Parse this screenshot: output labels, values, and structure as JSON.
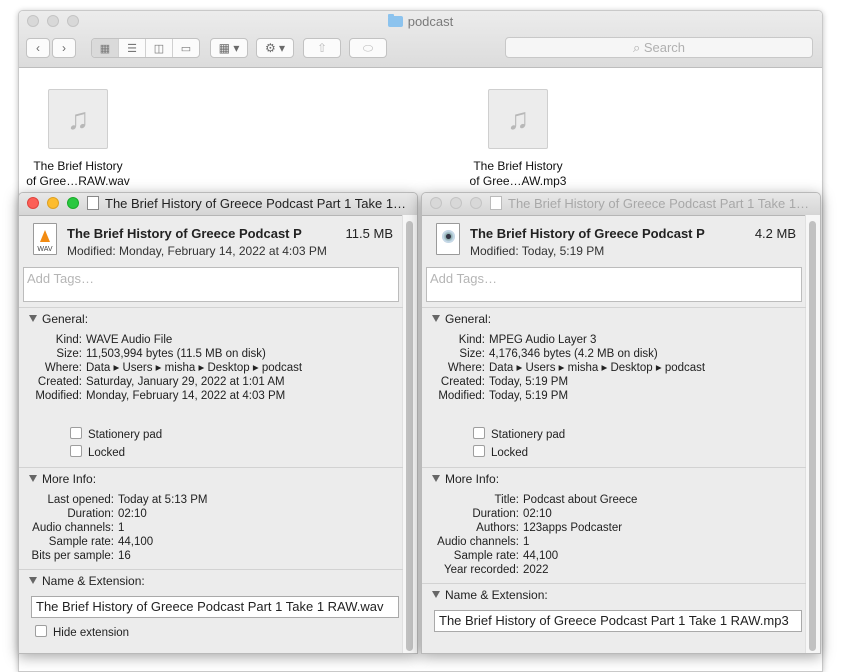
{
  "finder": {
    "title": "podcast",
    "search_placeholder": "Search",
    "files": [
      {
        "line1": "The Brief History",
        "line2": "of Gree…RAW.wav",
        "icon": "music-note-icon"
      },
      {
        "line1": "The Brief History",
        "line2": "of Gree…AW.mp3",
        "icon": "music-note-icon"
      }
    ]
  },
  "wav_info": {
    "window_title": "The Brief History of Greece Podcast Part 1 Take 1…",
    "name": "The Brief History of Greece Podcast Par…",
    "size": "11.5 MB",
    "modified_line": "Modified: Monday, February 14, 2022 at 4:03 PM",
    "icon_label": "WAV",
    "tags_placeholder": "Add Tags…",
    "general_label": "General:",
    "general": [
      {
        "k": "Kind:",
        "v": "WAVE Audio File"
      },
      {
        "k": "Size:",
        "v": "11,503,994 bytes (11.5 MB on disk)"
      },
      {
        "k": "Where:",
        "v": "Data ▸ Users ▸ misha ▸ Desktop ▸ podcast"
      },
      {
        "k": "Created:",
        "v": "Saturday, January 29, 2022 at 1:01 AM"
      },
      {
        "k": "Modified:",
        "v": "Monday, February 14, 2022 at 4:03 PM"
      }
    ],
    "stationery_label": "Stationery pad",
    "locked_label": "Locked",
    "more_info_label": "More Info:",
    "more_info": [
      {
        "k": "Last opened:",
        "v": "Today at 5:13 PM"
      },
      {
        "k": "Duration:",
        "v": "02:10"
      },
      {
        "k": "Audio channels:",
        "v": "1"
      },
      {
        "k": "Sample rate:",
        "v": "44,100"
      },
      {
        "k": "Bits per sample:",
        "v": "16"
      }
    ],
    "name_ext_label": "Name & Extension:",
    "name_ext_value": "The Brief History of Greece Podcast Part 1 Take 1 RAW.wav",
    "hide_ext_label": "Hide extension"
  },
  "mp3_info": {
    "window_title": "The Brief History of Greece Podcast Part 1 Take 1…",
    "name": "The Brief History of Greece Podcast Part…",
    "size": "4.2 MB",
    "modified_line": "Modified: Today, 5:19 PM",
    "tags_placeholder": "Add Tags…",
    "general_label": "General:",
    "general": [
      {
        "k": "Kind:",
        "v": "MPEG Audio Layer 3"
      },
      {
        "k": "Size:",
        "v": "4,176,346 bytes (4.2 MB on disk)"
      },
      {
        "k": "Where:",
        "v": "Data ▸ Users ▸ misha ▸ Desktop ▸ podcast"
      },
      {
        "k": "Created:",
        "v": "Today, 5:19 PM"
      },
      {
        "k": "Modified:",
        "v": "Today, 5:19 PM"
      }
    ],
    "stationery_label": "Stationery pad",
    "locked_label": "Locked",
    "more_info_label": "More Info:",
    "more_info": [
      {
        "k": "Title:",
        "v": "Podcast about Greece"
      },
      {
        "k": "Duration:",
        "v": "02:10"
      },
      {
        "k": "Authors:",
        "v": "123apps Podcaster"
      },
      {
        "k": "Audio channels:",
        "v": "1"
      },
      {
        "k": "Sample rate:",
        "v": "44,100"
      },
      {
        "k": "Year recorded:",
        "v": "2022"
      }
    ],
    "name_ext_label": "Name & Extension:",
    "name_ext_value": "The Brief History of Greece Podcast Part 1 Take 1 RAW.mp3"
  }
}
